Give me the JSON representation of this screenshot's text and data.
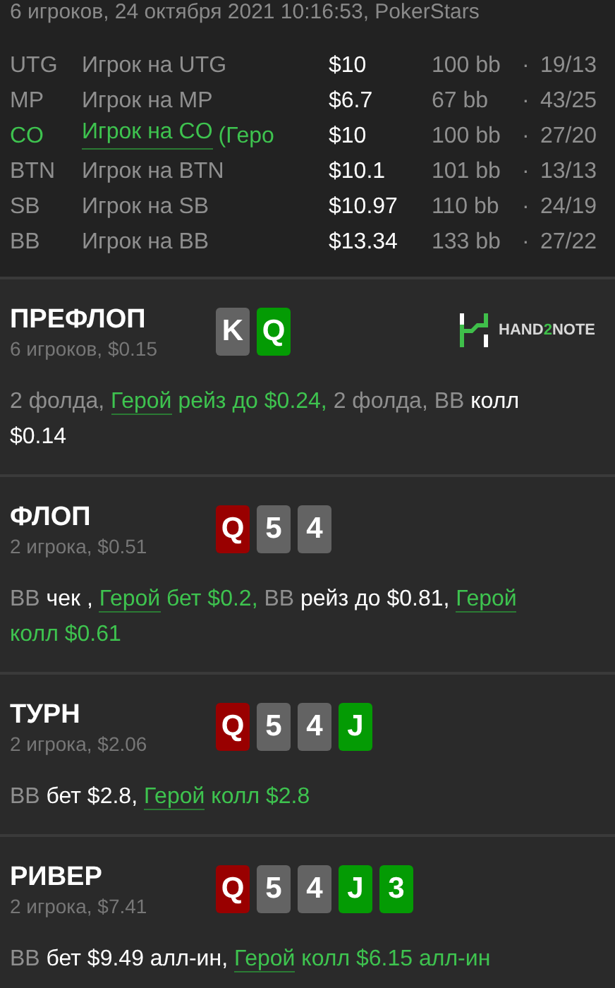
{
  "header": "6 игроков, 24 октября 2021 10:16:53, PokerStars",
  "players": [
    {
      "position": "UTG",
      "name": "Игрок на UTG",
      "hero": false,
      "stack": "$10",
      "bb": "100 bb",
      "separator": "·",
      "stats": "19/13"
    },
    {
      "position": "MP",
      "name": "Игрок на MP",
      "hero": false,
      "stack": "$6.7",
      "bb": "67 bb",
      "separator": "·",
      "stats": "43/25"
    },
    {
      "position": "CO",
      "name": "Игрок на CO",
      "note": "(Геро",
      "hero": true,
      "stack": "$10",
      "bb": "100 bb",
      "separator": "·",
      "stats": "27/20"
    },
    {
      "position": "BTN",
      "name": "Игрок на BTN",
      "hero": false,
      "stack": "$10.1",
      "bb": "101 bb",
      "separator": "·",
      "stats": "13/13"
    },
    {
      "position": "SB",
      "name": "Игрок на SB",
      "hero": false,
      "stack": "$10.97",
      "bb": "110 bb",
      "separator": "·",
      "stats": "24/19"
    },
    {
      "position": "BB",
      "name": "Игрок на BB",
      "hero": false,
      "stack": "$13.34",
      "bb": "133 bb",
      "separator": "·",
      "stats": "27/22"
    }
  ],
  "logo": {
    "part_1": "HAND",
    "part_2": "2",
    "part_3": "NOTE"
  },
  "streets": [
    {
      "title": "ПРЕФЛОП",
      "subtitle": "6 игроков, $0.15",
      "logo": true,
      "cards": [
        {
          "rank": "K",
          "color": "#636363"
        },
        {
          "rank": "Q",
          "color": "#049b04"
        }
      ],
      "actions": [
        {
          "kind": "other",
          "text": "2 фолда, "
        },
        {
          "kind": "hero_link",
          "text": "Герой"
        },
        {
          "kind": "hero",
          "text": " рейз до $0.24,"
        },
        {
          "kind": "other",
          "text": " 2 фолда, BB "
        },
        {
          "kind": "action",
          "text": "колл $0.14"
        }
      ]
    },
    {
      "title": "ФЛОП",
      "subtitle": "2 игрока, $0.51",
      "logo": false,
      "cards": [
        {
          "rank": "Q",
          "color": "#990000"
        },
        {
          "rank": "5",
          "color": "#636363"
        },
        {
          "rank": "4",
          "color": "#636363"
        }
      ],
      "actions": [
        {
          "kind": "other",
          "text": "BB "
        },
        {
          "kind": "action",
          "text": "чек , "
        },
        {
          "kind": "hero_link",
          "text": "Герой"
        },
        {
          "kind": "hero",
          "text": " бет $0.2,"
        },
        {
          "kind": "other",
          "text": " BB "
        },
        {
          "kind": "action",
          "text": "рейз до $0.81, "
        },
        {
          "kind": "hero_link",
          "text": "Герой"
        },
        {
          "kind": "hero",
          "text": " колл $0.61"
        }
      ]
    },
    {
      "title": "ТУРН",
      "subtitle": "2 игрока, $2.06",
      "logo": false,
      "cards": [
        {
          "rank": "Q",
          "color": "#990000"
        },
        {
          "rank": "5",
          "color": "#636363"
        },
        {
          "rank": "4",
          "color": "#636363"
        },
        {
          "rank": "J",
          "color": "#049b04"
        }
      ],
      "actions": [
        {
          "kind": "other",
          "text": "BB "
        },
        {
          "kind": "action",
          "text": "бет $2.8, "
        },
        {
          "kind": "hero_link",
          "text": "Герой"
        },
        {
          "kind": "hero",
          "text": " колл $2.8"
        }
      ]
    },
    {
      "title": "РИВЕР",
      "subtitle": "2 игрока, $7.41",
      "logo": false,
      "cards": [
        {
          "rank": "Q",
          "color": "#990000"
        },
        {
          "rank": "5",
          "color": "#636363"
        },
        {
          "rank": "4",
          "color": "#636363"
        },
        {
          "rank": "J",
          "color": "#049b04"
        },
        {
          "rank": "3",
          "color": "#049b04"
        }
      ],
      "actions": [
        {
          "kind": "other",
          "text": "BB "
        },
        {
          "kind": "action",
          "text": "бет $9.49 алл-ин, "
        },
        {
          "kind": "hero_link",
          "text": "Герой"
        },
        {
          "kind": "hero",
          "text": " колл $6.15 алл-ин"
        }
      ]
    }
  ]
}
